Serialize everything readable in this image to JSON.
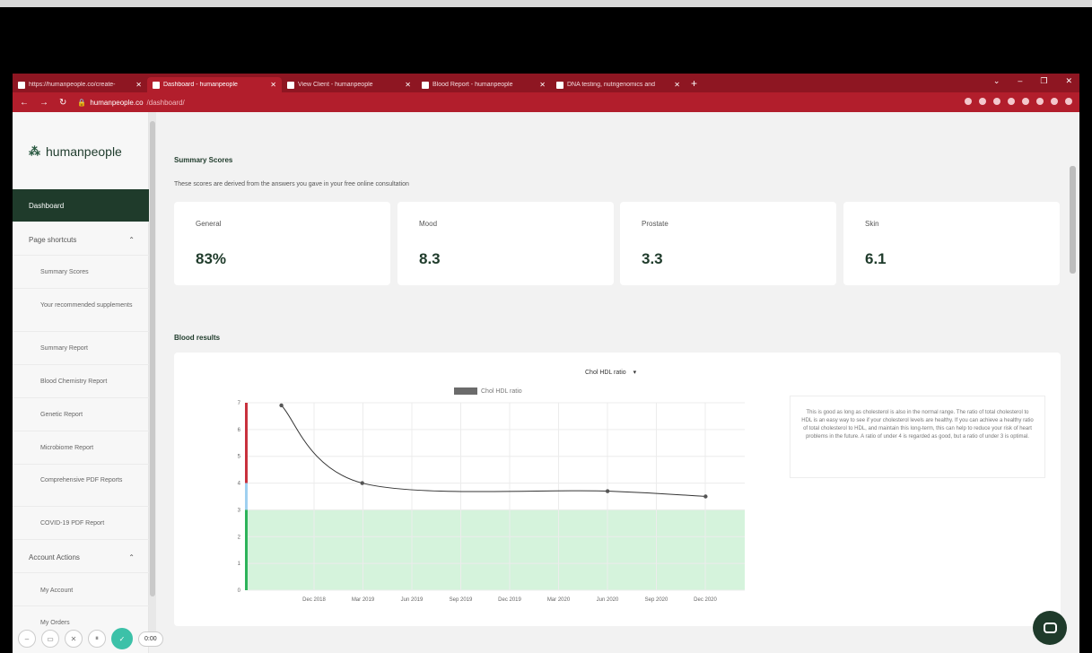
{
  "tabs": [
    {
      "title": "https://humanpeople.co/create-",
      "active": false
    },
    {
      "title": "Dashboard - humanpeople",
      "active": true
    },
    {
      "title": "View Client - humanpeople",
      "active": false
    },
    {
      "title": "Blood Report - humanpeople",
      "active": false
    },
    {
      "title": "DNA testing, nutrigenomics and",
      "active": false
    }
  ],
  "address": {
    "domain": "humanpeople.co",
    "path": "/dashboard/"
  },
  "sidebar": {
    "logo": "humanpeople",
    "dashboard": "Dashboard",
    "page_shortcuts": "Page shortcuts",
    "shortcuts": [
      "Summary Scores",
      "Your recommended supplements",
      "Summary Report",
      "Blood Chemistry Report",
      "Genetic Report",
      "Microbiome Report",
      "Comprehensive PDF Reports",
      "COVID-19 PDF Report"
    ],
    "account_actions": "Account Actions",
    "account_items": [
      "My Account",
      "My Orders"
    ]
  },
  "summary": {
    "title": "Summary Scores",
    "desc": "These scores are derived from the answers you gave in your free online consultation",
    "cards": [
      {
        "label": "General",
        "value": "83%"
      },
      {
        "label": "Mood",
        "value": "8.3"
      },
      {
        "label": "Prostate",
        "value": "3.3"
      },
      {
        "label": "Skin",
        "value": "6.1"
      }
    ]
  },
  "blood": {
    "title": "Blood results",
    "selected": "Chol HDL ratio",
    "info": "This is good as long as cholesterol is also in the normal range. The ratio of total cholesterol to HDL is an easy way to see if your cholesterol levels are healthy. If you can achieve a healthy ratio of total cholesterol to HDL, and maintain this long-term, this can help to reduce your risk of heart problems in the future. A ratio of under 4 is regarded as good, but a ratio of under 3 is optimal."
  },
  "chart_data": {
    "type": "line",
    "series": [
      {
        "name": "Chol HDL ratio",
        "x": [
          "2018-10-01",
          "2019-03-01",
          "2020-06-01",
          "2020-12-01"
        ],
        "values": [
          6.9,
          4.0,
          3.7,
          3.5
        ]
      }
    ],
    "x_ticks": [
      "Dec 2018",
      "Mar 2019",
      "Jun 2019",
      "Sep 2019",
      "Dec 2019",
      "Mar 2020",
      "Jun 2020",
      "Sep 2020",
      "Dec 2020"
    ],
    "y_ticks": [
      "0",
      "1",
      "2",
      "3",
      "4",
      "5",
      "6",
      "7"
    ],
    "ylim": [
      0,
      7
    ],
    "optimal_band": [
      0,
      3
    ],
    "colors": {
      "line": "#333333",
      "band": "#d5f3dc",
      "red": "#c8313d",
      "blue": "#9fd0f0",
      "green": "#2db35a"
    }
  },
  "recorder": {
    "time": "0:00"
  }
}
